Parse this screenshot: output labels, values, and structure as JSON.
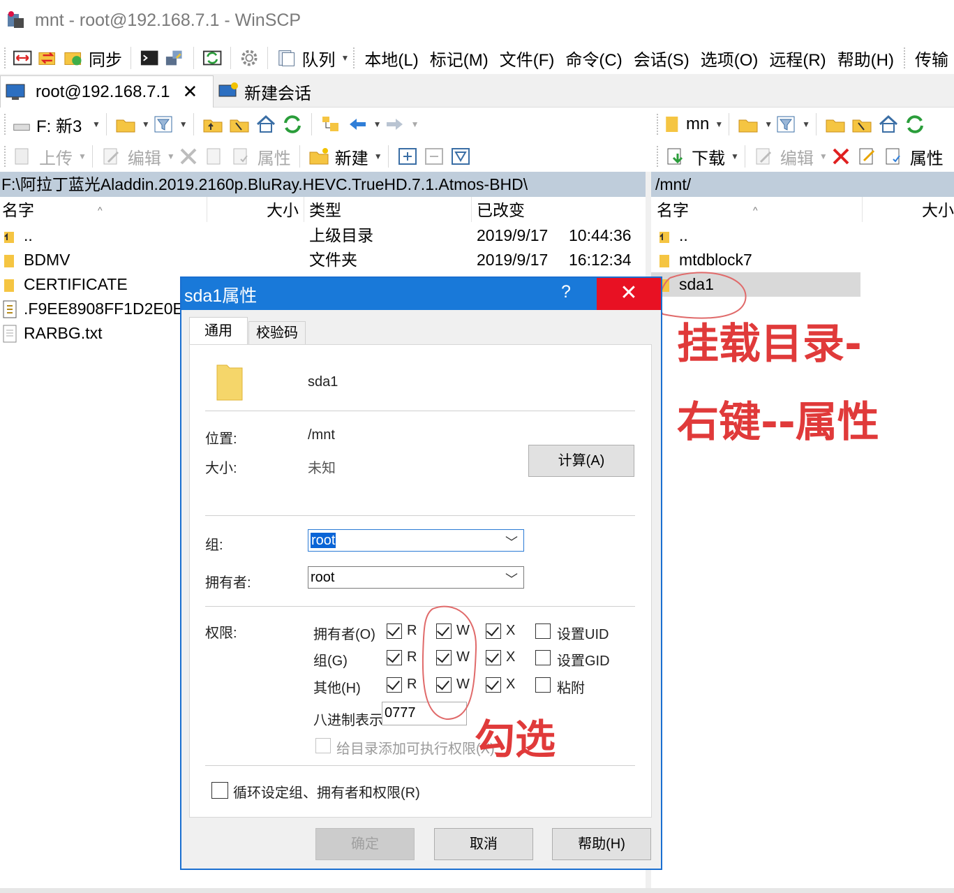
{
  "window": {
    "title": "mnt - root@192.168.7.1 - WinSCP"
  },
  "toolbar": {
    "sync_label": "同步",
    "queue_label": "队列",
    "menus": [
      "本地(L)",
      "标记(M)",
      "文件(F)",
      "命令(C)",
      "会话(S)",
      "选项(O)",
      "远程(R)",
      "帮助(H)",
      "传输"
    ]
  },
  "tabs": {
    "session": "root@192.168.7.1",
    "new_session": "新建会话"
  },
  "local": {
    "drive": "F: 新3",
    "upload": "上传",
    "edit": "编辑",
    "properties": "属性",
    "new": "新建",
    "path": "F:\\阿拉丁蓝光Aladdin.2019.2160p.BluRay.HEVC.TrueHD.7.1.Atmos-BHD\\",
    "columns": {
      "name": "名字",
      "size": "大小",
      "type": "类型",
      "modified": "已改变"
    },
    "rows": [
      {
        "name": "..",
        "type": "上级目录",
        "date": "2019/9/17",
        "time": "10:44:36"
      },
      {
        "name": "BDMV",
        "type": "文件夹",
        "date": "2019/9/17",
        "time": "16:12:34"
      },
      {
        "name": "CERTIFICATE",
        "type": "",
        "date": "",
        "time": ""
      },
      {
        "name": ".F9EE8908FF1D2E0E",
        "type": "",
        "date": "",
        "time": ""
      },
      {
        "name": "RARBG.txt",
        "type": "",
        "date": "",
        "time": ""
      }
    ]
  },
  "remote": {
    "drive": "mn",
    "download": "下载",
    "edit": "编辑",
    "properties": "属性",
    "path": "/mnt/",
    "columns": {
      "name": "名字",
      "size": "大小"
    },
    "rows": [
      {
        "name": ".."
      },
      {
        "name": "mtdblock7"
      },
      {
        "name": "sda1"
      }
    ]
  },
  "dialog": {
    "title": "sda1属性",
    "help_glyph": "?",
    "close_glyph": "✕",
    "tabs": [
      "通用",
      "校验码"
    ],
    "file_name": "sda1",
    "location_label": "位置:",
    "location_value": "/mnt",
    "size_label": "大小:",
    "size_value": "未知",
    "calc_button": "计算(A)",
    "group_label": "组:",
    "group_value": "root",
    "owner_label": "拥有者:",
    "owner_value": "root",
    "perm_label": "权限:",
    "perm_rows": [
      {
        "label": "拥有者(O)",
        "r": true,
        "w": true,
        "x": true,
        "special": "设置UID",
        "special_checked": false
      },
      {
        "label": "组(G)",
        "r": true,
        "w": true,
        "x": true,
        "special": "设置GID",
        "special_checked": false
      },
      {
        "label": "其他(H)",
        "r": true,
        "w": true,
        "x": true,
        "special": "粘附",
        "special_checked": false
      }
    ],
    "perm_letters": {
      "r": "R",
      "w": "W",
      "x": "X"
    },
    "octal_label": "八进制表示",
    "octal_value": "0777",
    "add_exec_label": "给目录添加可执行权限(X)",
    "recursive_label": "循环设定组、拥有者和权限(R)",
    "ok": "确定",
    "cancel": "取消",
    "help": "帮助(H)"
  },
  "annotations": {
    "note1": "挂载目录-",
    "note2": "右键--属性",
    "note3": "勾选",
    "color": "#e03a3a"
  }
}
